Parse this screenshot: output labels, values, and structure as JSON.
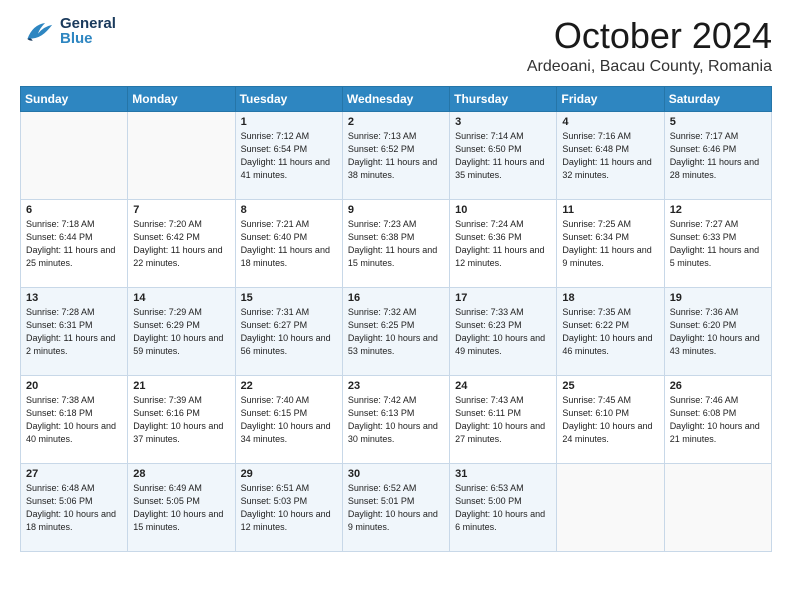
{
  "header": {
    "logo": {
      "general": "General",
      "blue": "Blue"
    },
    "title": "October 2024",
    "location": "Ardeoani, Bacau County, Romania"
  },
  "weekdays": [
    "Sunday",
    "Monday",
    "Tuesday",
    "Wednesday",
    "Thursday",
    "Friday",
    "Saturday"
  ],
  "weeks": [
    [
      {
        "day": "",
        "sunrise": "",
        "sunset": "",
        "daylight": ""
      },
      {
        "day": "",
        "sunrise": "",
        "sunset": "",
        "daylight": ""
      },
      {
        "day": "1",
        "sunrise": "Sunrise: 7:12 AM",
        "sunset": "Sunset: 6:54 PM",
        "daylight": "Daylight: 11 hours and 41 minutes."
      },
      {
        "day": "2",
        "sunrise": "Sunrise: 7:13 AM",
        "sunset": "Sunset: 6:52 PM",
        "daylight": "Daylight: 11 hours and 38 minutes."
      },
      {
        "day": "3",
        "sunrise": "Sunrise: 7:14 AM",
        "sunset": "Sunset: 6:50 PM",
        "daylight": "Daylight: 11 hours and 35 minutes."
      },
      {
        "day": "4",
        "sunrise": "Sunrise: 7:16 AM",
        "sunset": "Sunset: 6:48 PM",
        "daylight": "Daylight: 11 hours and 32 minutes."
      },
      {
        "day": "5",
        "sunrise": "Sunrise: 7:17 AM",
        "sunset": "Sunset: 6:46 PM",
        "daylight": "Daylight: 11 hours and 28 minutes."
      }
    ],
    [
      {
        "day": "6",
        "sunrise": "Sunrise: 7:18 AM",
        "sunset": "Sunset: 6:44 PM",
        "daylight": "Daylight: 11 hours and 25 minutes."
      },
      {
        "day": "7",
        "sunrise": "Sunrise: 7:20 AM",
        "sunset": "Sunset: 6:42 PM",
        "daylight": "Daylight: 11 hours and 22 minutes."
      },
      {
        "day": "8",
        "sunrise": "Sunrise: 7:21 AM",
        "sunset": "Sunset: 6:40 PM",
        "daylight": "Daylight: 11 hours and 18 minutes."
      },
      {
        "day": "9",
        "sunrise": "Sunrise: 7:23 AM",
        "sunset": "Sunset: 6:38 PM",
        "daylight": "Daylight: 11 hours and 15 minutes."
      },
      {
        "day": "10",
        "sunrise": "Sunrise: 7:24 AM",
        "sunset": "Sunset: 6:36 PM",
        "daylight": "Daylight: 11 hours and 12 minutes."
      },
      {
        "day": "11",
        "sunrise": "Sunrise: 7:25 AM",
        "sunset": "Sunset: 6:34 PM",
        "daylight": "Daylight: 11 hours and 9 minutes."
      },
      {
        "day": "12",
        "sunrise": "Sunrise: 7:27 AM",
        "sunset": "Sunset: 6:33 PM",
        "daylight": "Daylight: 11 hours and 5 minutes."
      }
    ],
    [
      {
        "day": "13",
        "sunrise": "Sunrise: 7:28 AM",
        "sunset": "Sunset: 6:31 PM",
        "daylight": "Daylight: 11 hours and 2 minutes."
      },
      {
        "day": "14",
        "sunrise": "Sunrise: 7:29 AM",
        "sunset": "Sunset: 6:29 PM",
        "daylight": "Daylight: 10 hours and 59 minutes."
      },
      {
        "day": "15",
        "sunrise": "Sunrise: 7:31 AM",
        "sunset": "Sunset: 6:27 PM",
        "daylight": "Daylight: 10 hours and 56 minutes."
      },
      {
        "day": "16",
        "sunrise": "Sunrise: 7:32 AM",
        "sunset": "Sunset: 6:25 PM",
        "daylight": "Daylight: 10 hours and 53 minutes."
      },
      {
        "day": "17",
        "sunrise": "Sunrise: 7:33 AM",
        "sunset": "Sunset: 6:23 PM",
        "daylight": "Daylight: 10 hours and 49 minutes."
      },
      {
        "day": "18",
        "sunrise": "Sunrise: 7:35 AM",
        "sunset": "Sunset: 6:22 PM",
        "daylight": "Daylight: 10 hours and 46 minutes."
      },
      {
        "day": "19",
        "sunrise": "Sunrise: 7:36 AM",
        "sunset": "Sunset: 6:20 PM",
        "daylight": "Daylight: 10 hours and 43 minutes."
      }
    ],
    [
      {
        "day": "20",
        "sunrise": "Sunrise: 7:38 AM",
        "sunset": "Sunset: 6:18 PM",
        "daylight": "Daylight: 10 hours and 40 minutes."
      },
      {
        "day": "21",
        "sunrise": "Sunrise: 7:39 AM",
        "sunset": "Sunset: 6:16 PM",
        "daylight": "Daylight: 10 hours and 37 minutes."
      },
      {
        "day": "22",
        "sunrise": "Sunrise: 7:40 AM",
        "sunset": "Sunset: 6:15 PM",
        "daylight": "Daylight: 10 hours and 34 minutes."
      },
      {
        "day": "23",
        "sunrise": "Sunrise: 7:42 AM",
        "sunset": "Sunset: 6:13 PM",
        "daylight": "Daylight: 10 hours and 30 minutes."
      },
      {
        "day": "24",
        "sunrise": "Sunrise: 7:43 AM",
        "sunset": "Sunset: 6:11 PM",
        "daylight": "Daylight: 10 hours and 27 minutes."
      },
      {
        "day": "25",
        "sunrise": "Sunrise: 7:45 AM",
        "sunset": "Sunset: 6:10 PM",
        "daylight": "Daylight: 10 hours and 24 minutes."
      },
      {
        "day": "26",
        "sunrise": "Sunrise: 7:46 AM",
        "sunset": "Sunset: 6:08 PM",
        "daylight": "Daylight: 10 hours and 21 minutes."
      }
    ],
    [
      {
        "day": "27",
        "sunrise": "Sunrise: 6:48 AM",
        "sunset": "Sunset: 5:06 PM",
        "daylight": "Daylight: 10 hours and 18 minutes."
      },
      {
        "day": "28",
        "sunrise": "Sunrise: 6:49 AM",
        "sunset": "Sunset: 5:05 PM",
        "daylight": "Daylight: 10 hours and 15 minutes."
      },
      {
        "day": "29",
        "sunrise": "Sunrise: 6:51 AM",
        "sunset": "Sunset: 5:03 PM",
        "daylight": "Daylight: 10 hours and 12 minutes."
      },
      {
        "day": "30",
        "sunrise": "Sunrise: 6:52 AM",
        "sunset": "Sunset: 5:01 PM",
        "daylight": "Daylight: 10 hours and 9 minutes."
      },
      {
        "day": "31",
        "sunrise": "Sunrise: 6:53 AM",
        "sunset": "Sunset: 5:00 PM",
        "daylight": "Daylight: 10 hours and 6 minutes."
      },
      {
        "day": "",
        "sunrise": "",
        "sunset": "",
        "daylight": ""
      },
      {
        "day": "",
        "sunrise": "",
        "sunset": "",
        "daylight": ""
      }
    ]
  ]
}
